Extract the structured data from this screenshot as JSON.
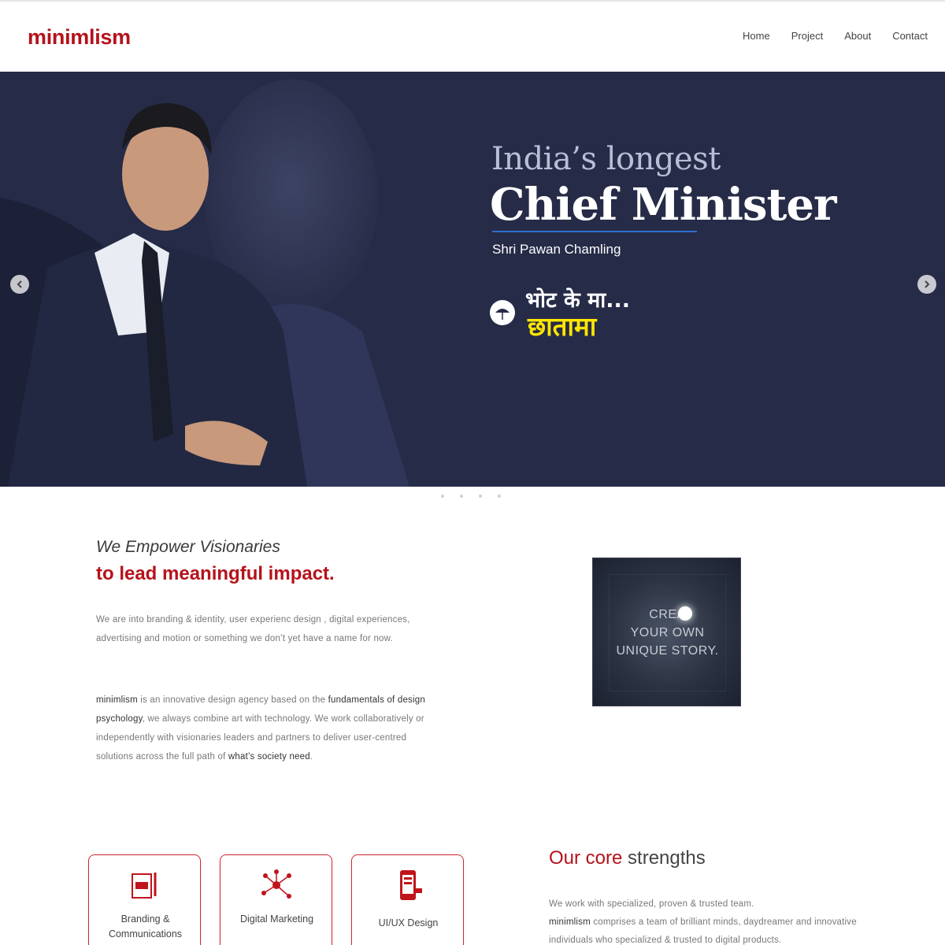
{
  "header": {
    "logo": "minimlism",
    "nav": [
      "Home",
      "Project",
      "About",
      "Contact"
    ]
  },
  "hero": {
    "subtitle": "India’s longest",
    "title": "Chief Minister",
    "name": "Shri Pawan Chamling",
    "slogan_top": "भोट के मा...",
    "slogan_bottom": "छातामा"
  },
  "empower": {
    "heading_italic": "We Empower Visionaries",
    "heading_bold": "to lead meaningful impact.",
    "para1": "We are into branding & identity, user experienc design  , digital experiences, advertising and motion or something we don’t yet have a name for now.",
    "para2_brand": "minimlism",
    "para2_a": " is an innovative design agency based on the ",
    "para2_b": "fundamentals of design psychology",
    "para2_c": ", we always combine art with technology. We work collaboratively or independently with visionaries leaders and partners to deliver user-centred solutions across the full path of ",
    "para2_d": "what’s society need",
    "para2_e": ".",
    "story_line1": "CREA",
    "story_line2": "YOUR OWN",
    "story_line3": "UNIQUE STORY."
  },
  "strengths": {
    "title_red": "Our core",
    "title_rest": " strengths",
    "text_line1": "We work with specialized, proven & trusted team.",
    "text_brand": "minimlism",
    "text_line2": " comprises a team of brilliant minds, daydreamer and innovative individuals who specialized & trusted to digital products.",
    "cards": [
      {
        "label": "Branding & Communications",
        "icon": "branding-icon"
      },
      {
        "label": "Digital Marketing",
        "icon": "network-icon"
      },
      {
        "label": "UI/UX Design",
        "icon": "mobile-design-icon"
      }
    ]
  },
  "colors": {
    "brand_red": "#b5121b",
    "hero_bg": "#262b47",
    "accent_blue": "#2f6fd1",
    "slogan_yellow": "#ffe600"
  }
}
